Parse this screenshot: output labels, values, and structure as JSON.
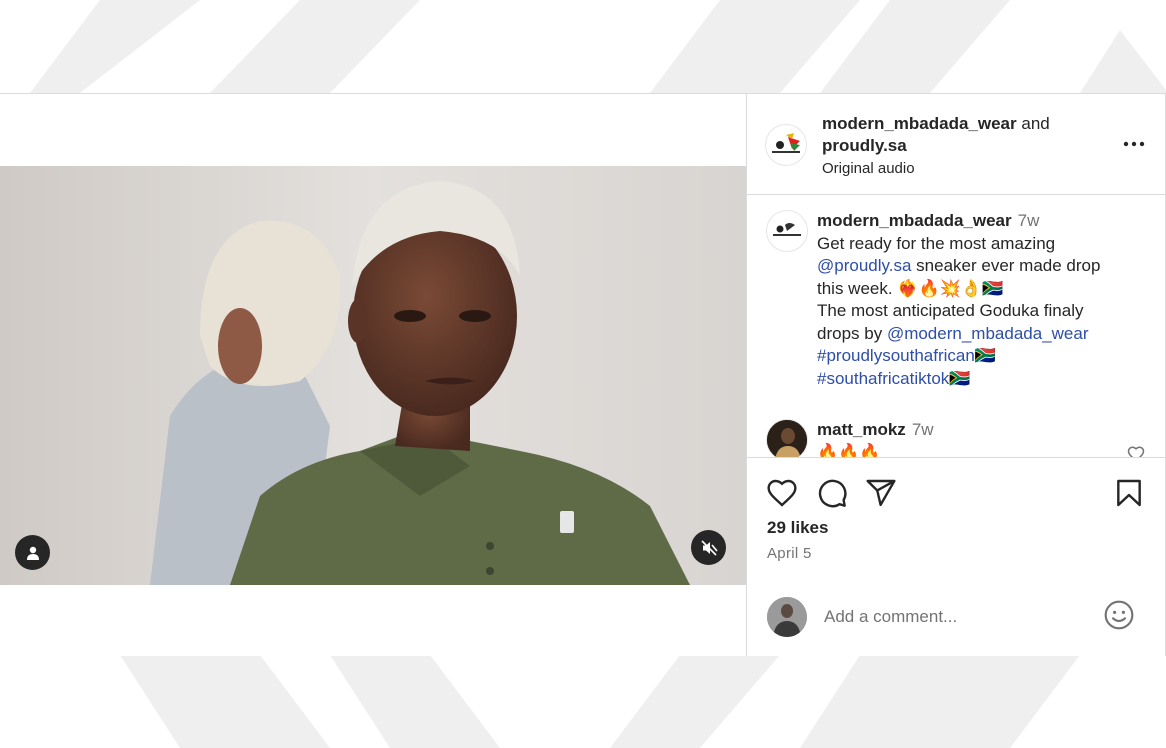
{
  "header": {
    "author": "modern_mbadada_wear",
    "joiner": "and",
    "coauthor": "proudly.sa",
    "audio": "Original audio"
  },
  "caption": {
    "username": "modern_mbadada_wear",
    "time": "7w",
    "line1": "Get ready for the most amazing",
    "mention1": "@proudly.sa",
    "line2": " sneaker ever made drop this week. ❤️‍🔥🔥💥👌🇿🇦",
    "line3": "The most anticipated Goduka finaly drops by ",
    "mention2": "@modern_mbadada_wear",
    "hashtag1": "#proudlysouthafrican",
    "flag1": "🇿🇦",
    "hashtag2": "#southafricatiktok",
    "flag2": "🇿🇦"
  },
  "comment": {
    "username": "matt_mokz",
    "time": "7w",
    "text": "🔥🔥🔥"
  },
  "likes": "29 likes",
  "date": "April 5",
  "comment_input": {
    "placeholder": "Add a comment..."
  },
  "icons": {
    "like": "heart-icon",
    "comment": "comment-bubble-icon",
    "share": "paper-plane-icon",
    "save": "bookmark-icon",
    "more": "more-options-icon",
    "emoji": "emoji-icon",
    "mute": "muted-speaker-icon",
    "tag": "user-tag-icon"
  }
}
